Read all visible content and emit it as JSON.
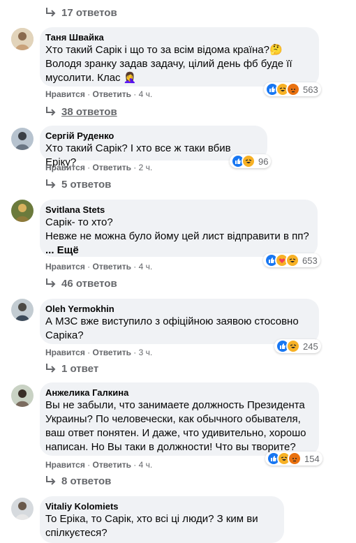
{
  "top_replies": {
    "label": "17 ответов"
  },
  "action_labels": {
    "like": "Нравится",
    "reply": "Ответить",
    "sep": " · "
  },
  "comments": [
    {
      "author": "Таня Швайка",
      "text": "Хто такий Сарік і що то за всім відома країна?🤔\nВолодя зранку задав задачу, цілий день фб буде її мусолити. Клас 🤦‍♀️",
      "time": "4 ч.",
      "reaction_icons": [
        "like-icon",
        "haha-icon",
        "angry-icon"
      ],
      "reaction_count": "563",
      "replies": "38 ответов"
    },
    {
      "author": "Сергій Руденко",
      "text": "Хто такий Сарік? І хто все ж таки вбив Еріку?",
      "time": "2 ч.",
      "reaction_icons": [
        "like-icon",
        "haha-icon"
      ],
      "reaction_count": "96",
      "replies": "5 ответов"
    },
    {
      "author": "Svitlana Stets",
      "text": "Сарік- то хто?\nНевже не можна було йому цей лист відправити в пп?",
      "more": "... Ещё",
      "time": "4 ч.",
      "reaction_icons": [
        "like-icon",
        "care-icon",
        "haha-icon"
      ],
      "reaction_count": "653",
      "replies": "46 ответов"
    },
    {
      "author": "Oleh Yermokhin",
      "text": "А МЗС вже виступило з офіційною заявою стосовно Саріка?",
      "time": "3 ч.",
      "reaction_icons": [
        "like-icon",
        "haha-icon"
      ],
      "reaction_count": "245",
      "replies": "1 ответ"
    },
    {
      "author": "Анжелика Галкина",
      "text": "Вы не забыли, что занимаете должность Президента Украины? По человечески, как обычного обывателя, ваш ответ понятен. И даже, что удивительно, хорошо написан. Но Вы таки в должности! Что вы творите?",
      "time": "4 ч.",
      "reaction_icons": [
        "like-icon",
        "haha-icon",
        "angry-icon"
      ],
      "reaction_count": "154",
      "replies": "8 ответов"
    },
    {
      "author": "Vitaliy Kolomiets",
      "text": "То Еріка, то Сарік, хто всі ці люди? З ким ви спілкуєтеся?"
    }
  ],
  "colors": {
    "bubble": "#f0f2f5",
    "meta": "#65676b",
    "like": "#1877f2",
    "haha": "#f7b125",
    "angry": "#e9710f"
  }
}
